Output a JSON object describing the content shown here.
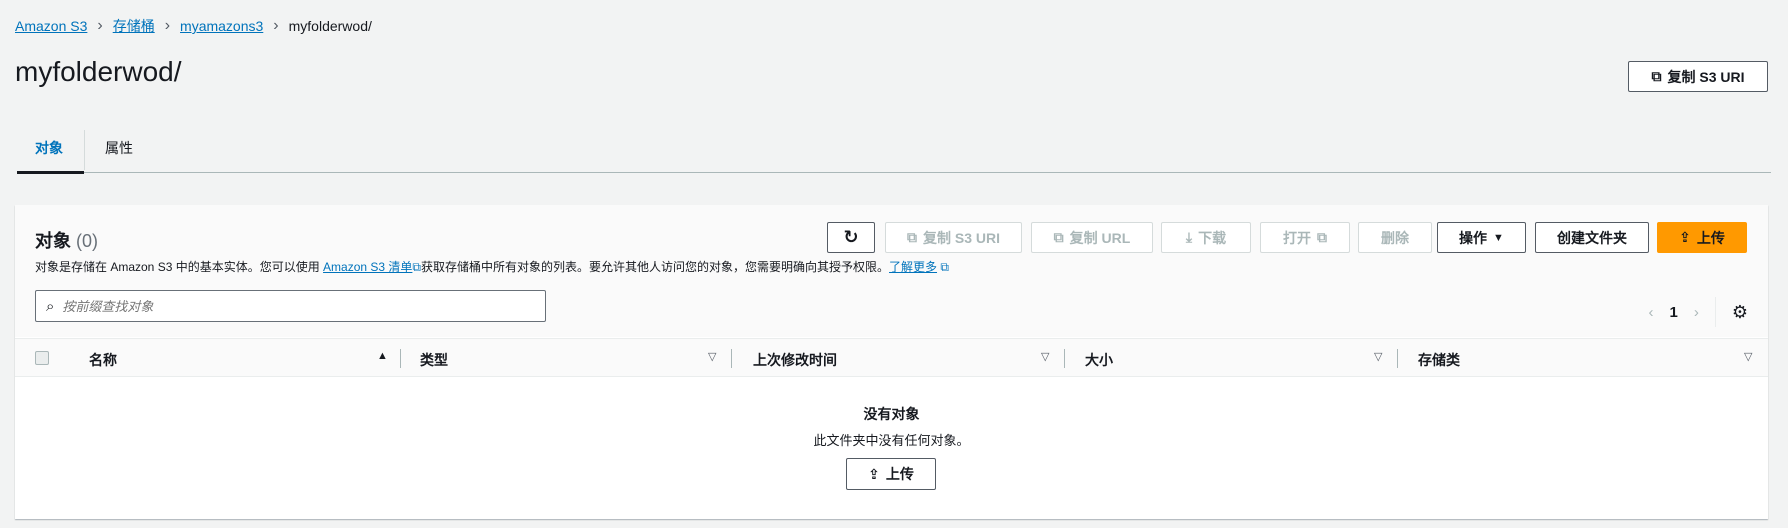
{
  "breadcrumb": [
    "Amazon S3",
    "存储桶",
    "myamazons3",
    "myfolderwod/"
  ],
  "page_title": "myfolderwod/",
  "copy_s3_uri_top": "复制 S3 URI",
  "tabs": [
    {
      "label": "对象",
      "active": true
    },
    {
      "label": "属性",
      "active": false
    }
  ],
  "objects": {
    "heading": "对象",
    "count": "(0)",
    "desc_before": "对象是存储在 Amazon S3 中的基本实体。您可以使用 ",
    "desc_link": "Amazon S3 清单",
    "desc_after": "获取存储桶中所有对象的列表。要允许其他人访问您的对象，您需要明确向其授予权限。",
    "learn_more": "了解更多",
    "toolbar": {
      "copy_s3_uri": "复制 S3 URI",
      "copy_url": "复制 URL",
      "download": "下载",
      "open": "打开",
      "delete": "删除",
      "actions": "操作",
      "create_folder": "创建文件夹",
      "upload": "上传"
    },
    "search_placeholder": "按前缀查找对象",
    "page": "1",
    "columns": [
      "名称",
      "类型",
      "上次修改时间",
      "大小",
      "存储类"
    ],
    "empty_title": "没有对象",
    "empty_desc": "此文件夹中没有任何对象。",
    "empty_upload": "上传"
  },
  "colors": {
    "link": "#0073bb",
    "primary": "#ff9900"
  }
}
